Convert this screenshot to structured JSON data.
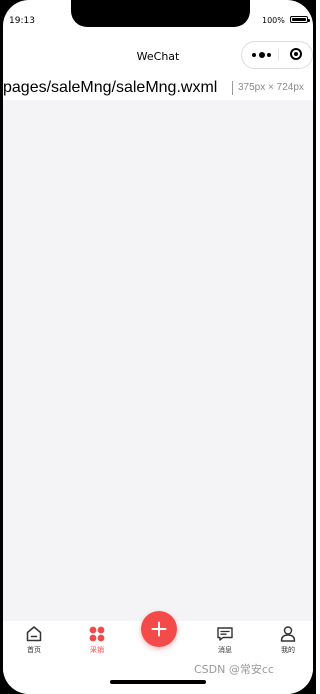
{
  "status_bar": {
    "time": "19:13",
    "battery": "100%"
  },
  "nav": {
    "title": "WeChat"
  },
  "capsule": {
    "menu_icon": "more-dots-icon",
    "close_icon": "target-close-icon"
  },
  "path_bar": {
    "path": "pages/saleMng/saleMng.wxml",
    "size": "375px × 724px"
  },
  "tabbar": {
    "tabs": [
      {
        "label": "首页",
        "icon": "home-icon",
        "active": false
      },
      {
        "label": "采销",
        "icon": "grid-icon",
        "active": true
      },
      {
        "label": "",
        "icon": "plus-icon",
        "active": false
      },
      {
        "label": "消息",
        "icon": "message-icon",
        "active": false
      },
      {
        "label": "我的",
        "icon": "user-icon",
        "active": false
      }
    ]
  },
  "watermark": "CSDN @常安cc",
  "colors": {
    "accent": "#f44a4a",
    "content_bg": "#f4f4f7"
  }
}
